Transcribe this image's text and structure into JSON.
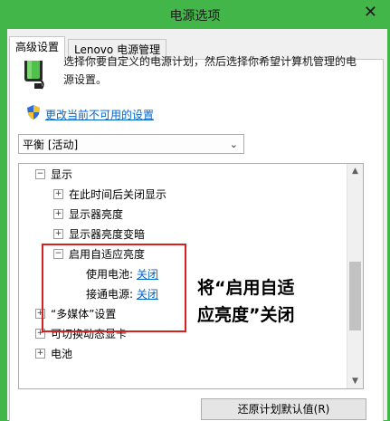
{
  "window": {
    "title": "电源选项",
    "close_glyph": "✕"
  },
  "tabs": [
    {
      "label": "高级设置"
    },
    {
      "label": "Lenovo 电源管理"
    }
  ],
  "intro": {
    "text": "选择你要自定义的电源计划，然后选择你希望计算机管理的电源设置。"
  },
  "change_link": {
    "label": "更改当前不可用的设置"
  },
  "plan_select": {
    "value": "平衡 [活动]",
    "caret": "⌄"
  },
  "tree": {
    "display": {
      "label": "显示",
      "toggle": "−"
    },
    "turn_off_after": {
      "label": "在此时间后关闭显示",
      "toggle": "+"
    },
    "brightness": {
      "label": "显示器亮度",
      "toggle": "+"
    },
    "dimmed_brightness": {
      "label": "显示器亮度变暗",
      "toggle": "+"
    },
    "adaptive": {
      "label": "启用自适应亮度",
      "toggle": "−",
      "battery": {
        "label": "使用电池:",
        "value": "关闭"
      },
      "plugged": {
        "label": "接通电源:",
        "value": "关闭"
      }
    },
    "multimedia": {
      "label": "“多媒体”设置",
      "toggle": "+"
    },
    "switchable_gpu": {
      "label": "可切换动态显卡",
      "toggle": "+"
    },
    "battery": {
      "label": "电池",
      "toggle": "+"
    }
  },
  "annotation": {
    "line1": "将“启用自适",
    "line2": "应亮度”关闭"
  },
  "restore_button": {
    "label": "还原计划默认值(R)"
  },
  "colors": {
    "accent_green": "#43b649",
    "link_blue": "#0066cc",
    "highlight_red": "#d8201f"
  }
}
